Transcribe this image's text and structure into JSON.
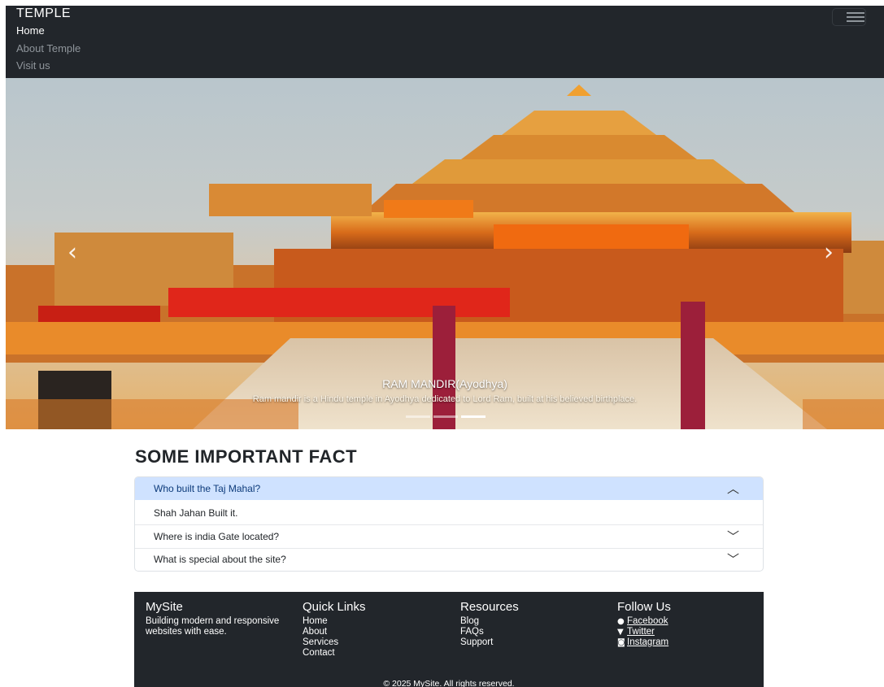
{
  "navbar": {
    "brand": "TEMPLE",
    "links": [
      {
        "label": "Home",
        "active": true
      },
      {
        "label": "About Temple",
        "active": false
      },
      {
        "label": "Visit us",
        "active": false
      }
    ]
  },
  "carousel": {
    "prev_icon": "‹",
    "next_icon": "›",
    "caption_title": "RAM MANDIR(Ayodhya)",
    "caption_text": "Ram mandir is a Hindu temple in Ayodhya dedicated to Lord Ram, built at his believed birthplace.",
    "active_slide": 2,
    "slide_count": 3
  },
  "faq": {
    "title": "SOME IMPORTANT FACT",
    "items": [
      {
        "question": "Who built the Taj Mahal?",
        "answer": "Shah Jahan Built it.",
        "open": true
      },
      {
        "question": "Where is india Gate located?",
        "open": false
      },
      {
        "question": "What is special about the site?",
        "open": false
      }
    ]
  },
  "footer": {
    "brand": "MySite",
    "tagline": "Building modern and responsive websites with ease.",
    "quick_links_title": "Quick Links",
    "quick_links": [
      "Home",
      "About",
      "Services",
      "Contact"
    ],
    "resources_title": "Resources",
    "resources": [
      "Blog",
      "FAQs",
      "Support"
    ],
    "follow_title": "Follow Us",
    "social": [
      {
        "label": "Facebook",
        "icon": "facebook-icon"
      },
      {
        "label": "Twitter",
        "icon": "twitter-icon"
      },
      {
        "label": "Instagram",
        "icon": "instagram-icon"
      }
    ],
    "copyright": "© 2025 MySite. All rights reserved."
  },
  "colors": {
    "navbar_bg": "#22262b",
    "accordion_active_bg": "#cfe2ff",
    "footer_bg": "#22262b"
  }
}
